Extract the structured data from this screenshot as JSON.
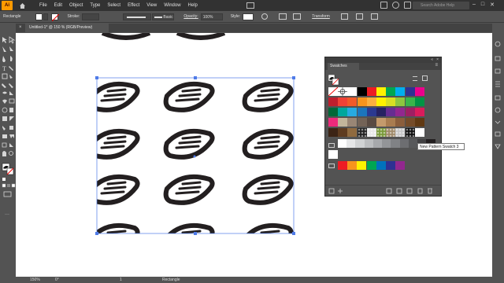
{
  "menubar": {
    "logo": "Ai",
    "items": [
      "File",
      "Edit",
      "Object",
      "Type",
      "Select",
      "Effect",
      "View",
      "Window",
      "Help"
    ],
    "help_search_placeholder": "Search Adobe Help"
  },
  "controlbar": {
    "selection_label": "Rectangle",
    "stroke_label": "Stroke:",
    "brush_label": "Basic",
    "opacity_label": "Opacity:",
    "opacity_value": "100%",
    "style_label": "Style:",
    "transform_label": "Transform"
  },
  "document": {
    "tab_title": "Untitled-1* @ 150 % (RGB/Preview)",
    "close_glyph": "×"
  },
  "swatches_panel": {
    "title": "Swatches",
    "tooltip": "New Pattern Swatch 3",
    "colors": {
      "row1": [
        "#ffffff",
        "#000000",
        "#ed1c24",
        "#fff200",
        "#00a651",
        "#00aeef",
        "#2e3192",
        "#ec008c"
      ],
      "row2": [
        "#be1e2d",
        "#ef4136",
        "#f15a29",
        "#f7941d",
        "#fbb040",
        "#fff200",
        "#d7df23",
        "#8dc63f",
        "#39b54a",
        "#009444"
      ],
      "row3": [
        "#006838",
        "#00a79d",
        "#27aae1",
        "#1c75bc",
        "#2b3990",
        "#262262",
        "#662d91",
        "#92278f",
        "#9e1f63",
        "#da1c5c"
      ],
      "row4": [
        "#ee2a7b",
        "#c2b59b",
        "#998675",
        "#736357",
        "#594a42",
        "#c49a6c",
        "#a97c50",
        "#8b5e3c",
        "#754c29",
        "#603913"
      ],
      "row5": [
        "#3c2415",
        "#5e3b1f",
        "#8f6a3f"
      ],
      "grays": [
        "#ffffff",
        "#e6e7e8",
        "#d1d3d4",
        "#bcbec0",
        "#a7a9ac",
        "#939598",
        "#808285",
        "#6d6e71",
        "#58595b",
        "#414042",
        "#231f20"
      ],
      "bright": [
        "#ed1c24",
        "#f7941d",
        "#fff200",
        "#00a651",
        "#0072bc",
        "#2e3192",
        "#92278f"
      ]
    }
  },
  "statusbar": {
    "zoom": "150%",
    "rotation": "0°",
    "page": "1",
    "tool": "Rectangle"
  }
}
